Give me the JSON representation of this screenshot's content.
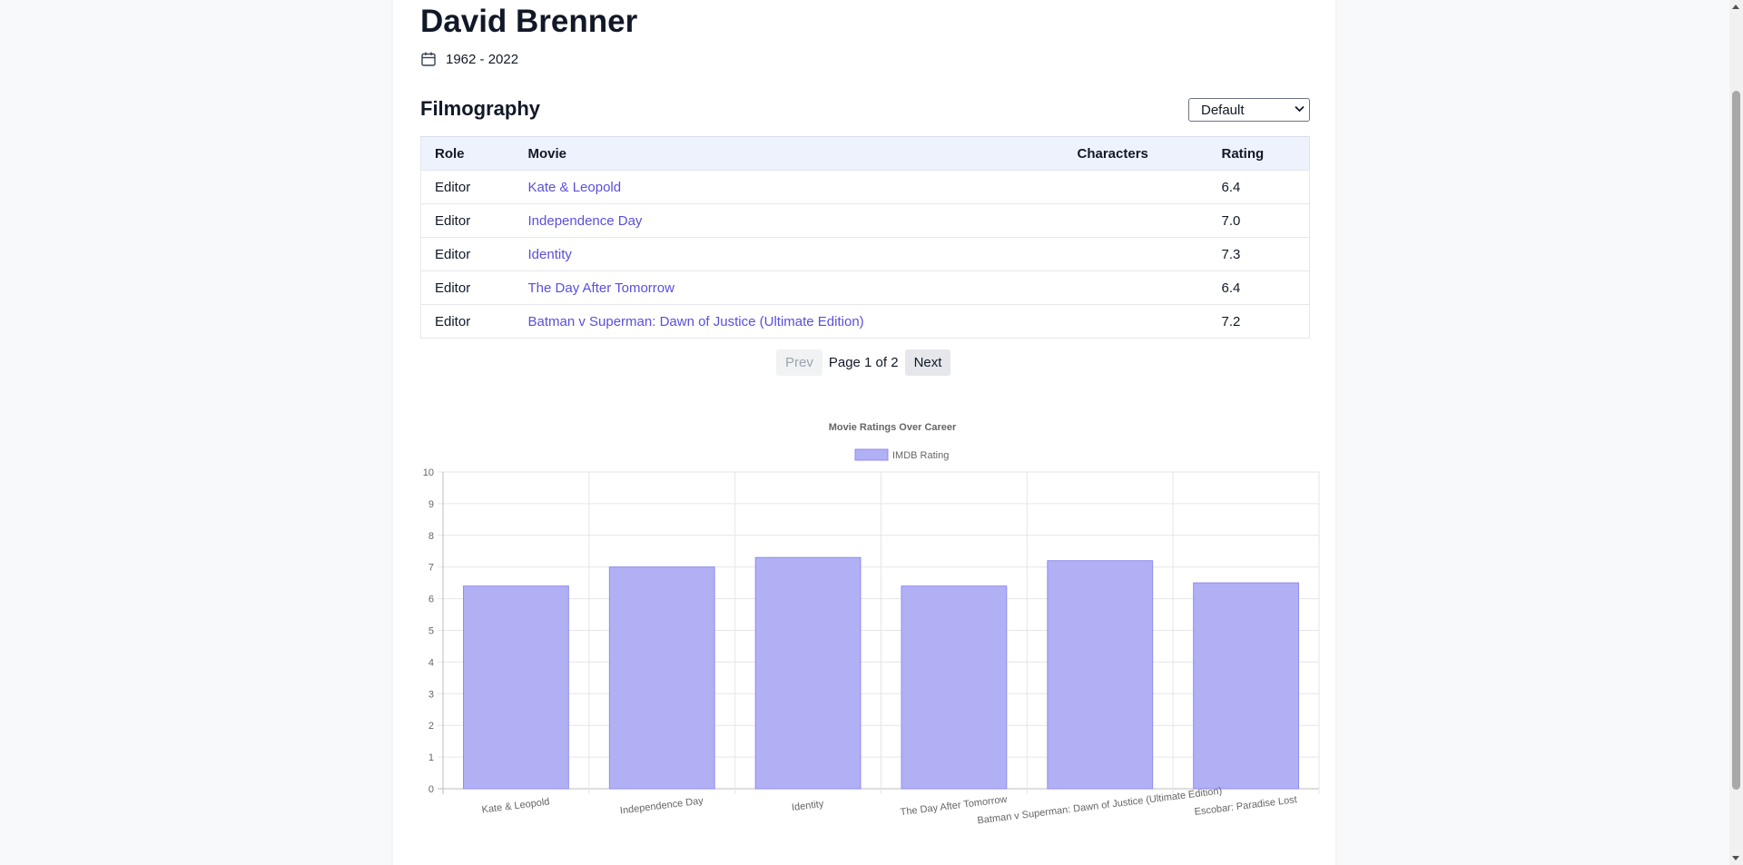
{
  "person": {
    "name": "David Brenner",
    "years": "1962 - 2022"
  },
  "filmography": {
    "title": "Filmography",
    "sort": {
      "selected": "Default"
    },
    "columns": [
      "Role",
      "Movie",
      "Characters",
      "Rating"
    ],
    "rows": [
      {
        "role": "Editor",
        "movie": "Kate & Leopold",
        "characters": "",
        "rating": "6.4"
      },
      {
        "role": "Editor",
        "movie": "Independence Day",
        "characters": "",
        "rating": "7.0"
      },
      {
        "role": "Editor",
        "movie": "Identity",
        "characters": "",
        "rating": "7.3"
      },
      {
        "role": "Editor",
        "movie": "The Day After Tomorrow",
        "characters": "",
        "rating": "6.4"
      },
      {
        "role": "Editor",
        "movie": "Batman v Superman: Dawn of Justice (Ultimate Edition)",
        "characters": "",
        "rating": "7.2"
      }
    ]
  },
  "pagination": {
    "prev_label": "Prev",
    "status": "Page 1 of 2",
    "next_label": "Next"
  },
  "colors": {
    "link": "#5a4fdc",
    "bar_fill": "#b1b0f5",
    "bar_stroke": "#8f8cf0"
  },
  "icons": {
    "dates": "calendar-icon",
    "sort": "chevron-down-icon"
  },
  "chart_data": {
    "type": "bar",
    "title": "Movie Ratings Over Career",
    "categories": [
      "Kate & Leopold",
      "Independence Day",
      "Identity",
      "The Day After Tomorrow",
      "Batman v Superman: Dawn of Justice (Ultimate Edition)",
      "Escobar: Paradise Lost"
    ],
    "series": [
      {
        "name": "IMDB Rating",
        "values": [
          6.4,
          7.0,
          7.3,
          6.4,
          7.2,
          6.5
        ]
      }
    ],
    "ylim": [
      0,
      10
    ],
    "yticks": [
      0,
      1,
      2,
      3,
      4,
      5,
      6,
      7,
      8,
      9,
      10
    ],
    "grid": true,
    "legend": "top-center"
  }
}
